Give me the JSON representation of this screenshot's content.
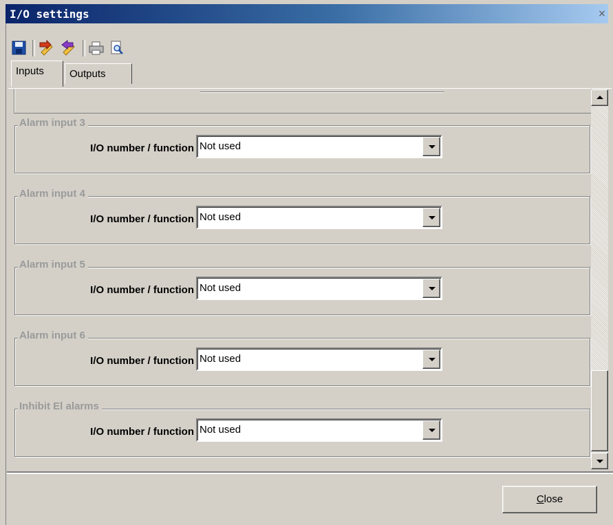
{
  "window": {
    "title": "I/O settings",
    "close_glyph": "×"
  },
  "toolbar": {
    "buttons": [
      {
        "icon": "save-icon"
      },
      {
        "icon": "import-icon"
      },
      {
        "icon": "export-icon"
      },
      {
        "icon": "print-icon"
      },
      {
        "icon": "print-preview-icon"
      }
    ]
  },
  "tabs": [
    {
      "label": "Inputs",
      "active": true
    },
    {
      "label": "Outputs",
      "active": false
    }
  ],
  "groups": [
    {
      "title": "Alarm input 3",
      "field_label": "I/O number / function",
      "value": "Not used"
    },
    {
      "title": "Alarm input 4",
      "field_label": "I/O number / function",
      "value": "Not used"
    },
    {
      "title": "Alarm input 5",
      "field_label": "I/O number / function",
      "value": "Not used"
    },
    {
      "title": "Alarm input 6",
      "field_label": "I/O number / function",
      "value": "Not used"
    },
    {
      "title": "Inhibit El alarms",
      "field_label": "I/O number / function",
      "value": "Not used"
    }
  ],
  "footer": {
    "close_label_accel": "C",
    "close_label_rest": "lose"
  },
  "colors": {
    "face": "#d4d0c8",
    "title_start": "#0a246a",
    "title_end": "#a6caf0",
    "group_title": "#9a9a9a"
  }
}
